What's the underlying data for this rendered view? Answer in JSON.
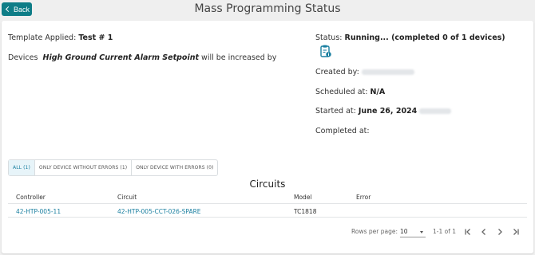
{
  "header": {
    "back_label": "Back",
    "title": "Mass Programming Status"
  },
  "summary": {
    "template_prefix": "Template Applied:",
    "template_value": "Test # 1",
    "devices_prefix": "Devices",
    "devices_setting": "High Ground Current Alarm Setpoint",
    "devices_suffix": "will be increased by"
  },
  "status": {
    "status_prefix": "Status:",
    "status_value": "Running... (completed 0 of 1 devices)",
    "created_by_label": "Created by:",
    "scheduled_label": "Scheduled at:",
    "scheduled_value": "N/A",
    "started_label": "Started at:",
    "started_value": "June 26, 2024",
    "completed_label": "Completed at:"
  },
  "tabs": [
    {
      "label": "ALL (1)",
      "active": true
    },
    {
      "label": "ONLY DEVICE WITHOUT ERRORS (1)",
      "active": false
    },
    {
      "label": "ONLY DEVICE WITH ERRORS (0)",
      "active": false
    }
  ],
  "table": {
    "title": "Circuits",
    "columns": [
      "Controller",
      "Circuit",
      "Model",
      "Error"
    ],
    "rows": [
      {
        "controller": "42-HTP-005-11",
        "circuit": "42-HTP-005-CCT-026-SPARE",
        "model": "TC1818",
        "error": ""
      }
    ]
  },
  "pagination": {
    "rows_per_page_label": "Rows per page:",
    "rows_per_page_value": "10",
    "range": "1-1 of 1"
  },
  "icons": [
    "chevron-left-icon",
    "clipboard-info-icon",
    "first-page-icon",
    "prev-page-icon",
    "next-page-icon",
    "last-page-icon"
  ],
  "colors": {
    "accent": "#0e7d87",
    "link": "#1a7fa0",
    "active_tab_bg": "#e7f4f9"
  }
}
